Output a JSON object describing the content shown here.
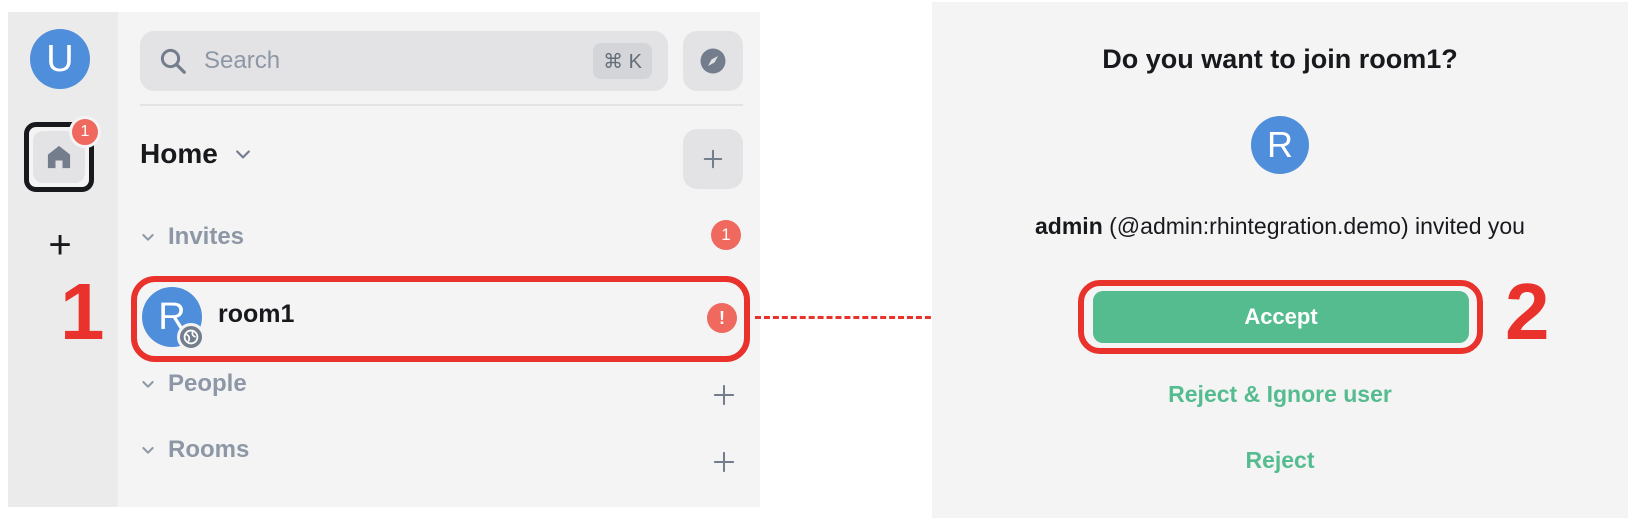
{
  "space_bar": {
    "user_avatar_letter": "U",
    "home_badge_count": "1",
    "add_space_label": "+"
  },
  "annotations": {
    "step1": "1",
    "step2": "2"
  },
  "search": {
    "placeholder": "Search",
    "shortcut": "⌘ K"
  },
  "room_list": {
    "header_title": "Home",
    "sections": {
      "invites": {
        "label": "Invites",
        "badge": "1"
      },
      "people": {
        "label": "People"
      },
      "rooms": {
        "label": "Rooms"
      }
    },
    "invited_room": {
      "avatar_letter": "R",
      "name": "room1",
      "badge": "!"
    }
  },
  "invite_dialog": {
    "title": "Do you want to join room1?",
    "avatar_letter": "R",
    "inviter_name": "admin",
    "inviter_detail": " (@admin:rhintegration.demo) invited you",
    "accept_label": "Accept",
    "reject_ignore_label": "Reject & Ignore user",
    "reject_label": "Reject"
  },
  "colors": {
    "accent_green": "#54bc8e",
    "annotation_red": "#e8322b",
    "badge_red": "#f0695f",
    "avatar_blue": "#4f8edb"
  },
  "icons": [
    "search-icon",
    "explore-compass-icon",
    "home-icon",
    "chevron-down-icon",
    "plus-icon",
    "globe-icon"
  ]
}
